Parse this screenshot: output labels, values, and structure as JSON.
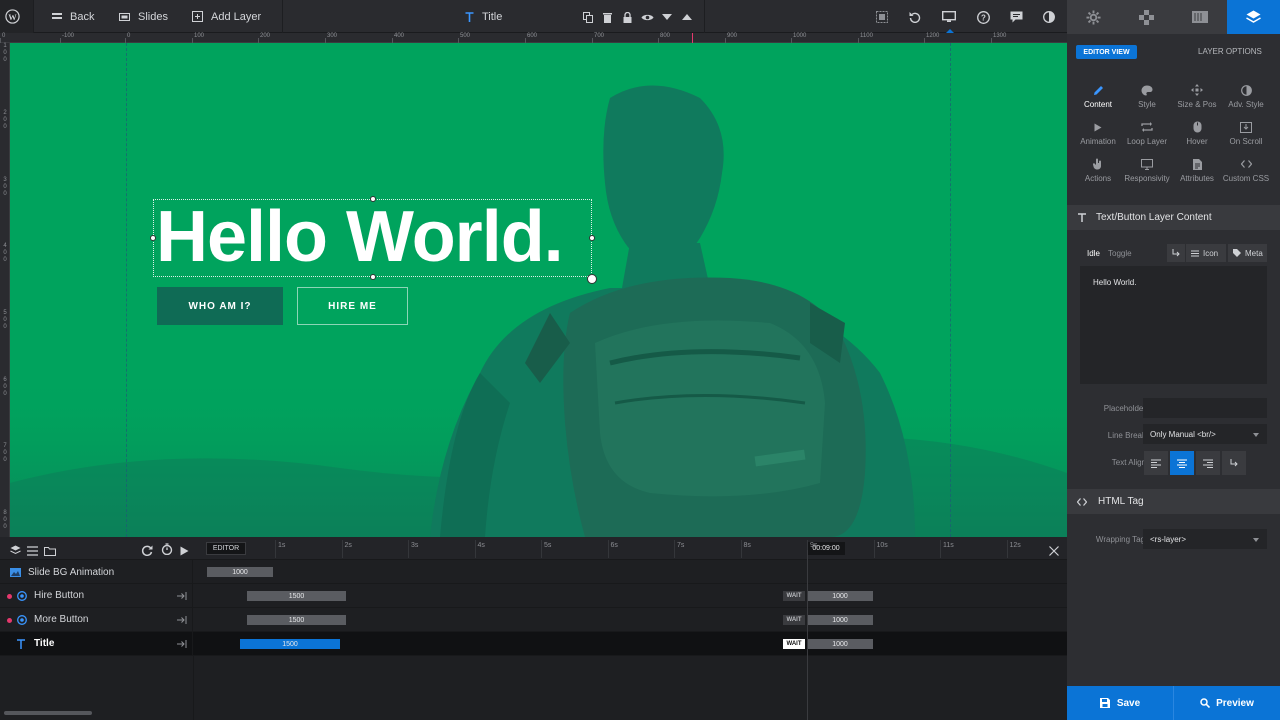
{
  "topbar": {
    "back": "Back",
    "slides": "Slides",
    "add_layer": "Add Layer",
    "current_layer": "Title"
  },
  "ruler": {
    "top_labels": [
      "0",
      "-100",
      "0",
      "100",
      "200",
      "300",
      "400",
      "500",
      "600",
      "700",
      "800",
      "900",
      "1000",
      "1100",
      "1200",
      "1300"
    ],
    "left_labels": [
      "1",
      "0",
      "0",
      "2",
      "0",
      "0",
      "3",
      "0",
      "0",
      "4",
      "0",
      "0",
      "5",
      "0",
      "0",
      "6",
      "0",
      "0",
      "7",
      "0",
      "0",
      "8",
      "0",
      "0"
    ]
  },
  "canvas": {
    "headline": "Hello World.",
    "button1": "WHO AM I?",
    "button2": "HIRE ME",
    "bg_color": "#00a35d"
  },
  "timeline": {
    "editor_label": "EDITOR",
    "seconds": [
      "1s",
      "2s",
      "3s",
      "4s",
      "5s",
      "6s",
      "7s",
      "8s",
      "9s",
      "10s",
      "11s",
      "12s"
    ],
    "time_marker": "00:09:00",
    "rows": [
      {
        "name": "Slide BG Animation",
        "bar_value": "1000"
      },
      {
        "name": "Hire Button",
        "bar_value": "1500",
        "wait": "WAIT",
        "end_value": "1000"
      },
      {
        "name": "More Button",
        "bar_value": "1500",
        "wait": "WAIT",
        "end_value": "1000"
      },
      {
        "name": "Title",
        "bar_value": "1500",
        "wait": "WAIT",
        "end_value": "1000"
      }
    ]
  },
  "panel": {
    "editor_view": "EDITOR VIEW",
    "layer_options": "LAYER OPTIONS",
    "options": [
      {
        "label": "Content",
        "icon": "pencil-icon"
      },
      {
        "label": "Style",
        "icon": "palette-icon"
      },
      {
        "label": "Size & Pos",
        "icon": "move-icon"
      },
      {
        "label": "Adv. Style",
        "icon": "contrast-icon"
      },
      {
        "label": "Animation",
        "icon": "play-icon"
      },
      {
        "label": "Loop Layer",
        "icon": "loop-icon"
      },
      {
        "label": "Hover",
        "icon": "mouse-icon"
      },
      {
        "label": "On Scroll",
        "icon": "scroll-icon"
      },
      {
        "label": "Actions",
        "icon": "hand-icon"
      },
      {
        "label": "Responsivity",
        "icon": "screen-icon"
      },
      {
        "label": "Attributes",
        "icon": "file-icon"
      },
      {
        "label": "Custom CSS",
        "icon": "code-icon"
      }
    ],
    "content_section": "Text/Button Layer Content",
    "idle": "Idle",
    "toggle": "Toggle",
    "icon_label": "Icon",
    "meta_label": "Meta",
    "content_value": "Hello World.",
    "placeholder_label": "Placeholder",
    "line_break_label": "Line Break",
    "line_break_value": "Only Manual <br/>",
    "text_align_label": "Text Align",
    "html_tag_section": "HTML Tag",
    "wrapping_tag_label": "Wrapping Tag",
    "wrapping_tag_value": "<rs-layer>",
    "save": "Save",
    "preview": "Preview",
    "accent": "#0b74d6"
  }
}
